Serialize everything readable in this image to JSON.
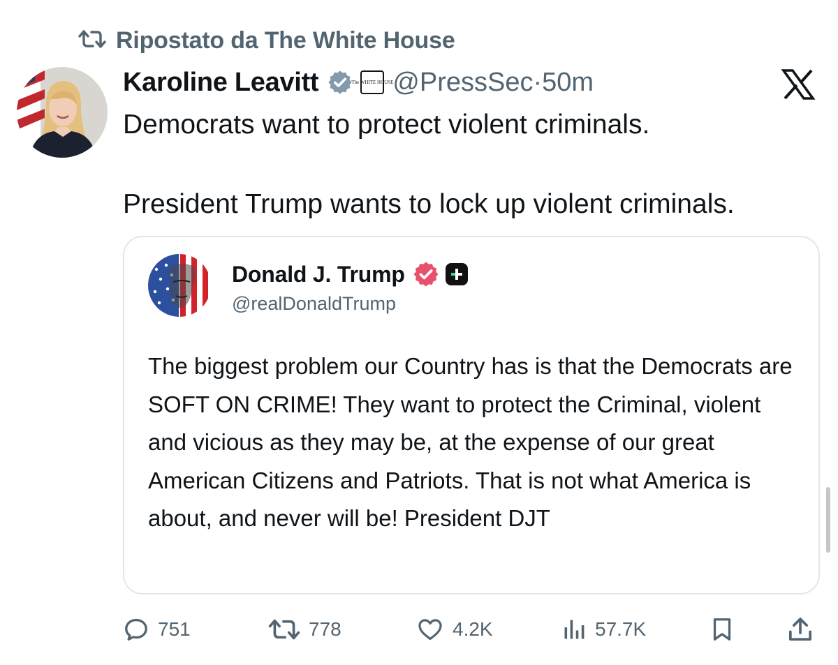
{
  "repost": {
    "label": "Ripostato da The White House",
    "icon": "repost-icon"
  },
  "author": {
    "name": "Karoline Leavitt",
    "affiliate_badge_text": "The WHITE HOUSE",
    "handle": "@PressSec",
    "separator": "·",
    "time": "50m",
    "avatar": "avatar-karoline-leavitt"
  },
  "platform_logo": "x-logo-icon",
  "tweet": {
    "line1": "Democrats want to protect violent criminals.",
    "line2": "President Trump wants to lock up violent criminals."
  },
  "quoted": {
    "name": "Donald J. Trump",
    "handle": "@realDonaldTrump",
    "body": "The biggest problem our Country has is that the Democrats are SOFT ON CRIME! They want to protect the Criminal, violent and vicious as they may be, at the expense of our great American Citizens and Patriots. That is not what America is about, and never will be! President DJT",
    "verified_color": "#e8506e"
  },
  "actions": {
    "replies": "751",
    "reposts": "778",
    "likes": "4.2K",
    "views": "57.7K",
    "bookmark_icon": "bookmark-icon",
    "share_icon": "share-icon"
  },
  "colors": {
    "verified_gray": "#829aab",
    "secondary_text": "#536471",
    "primary_text": "#0f1419",
    "border": "#e3e6e9"
  }
}
